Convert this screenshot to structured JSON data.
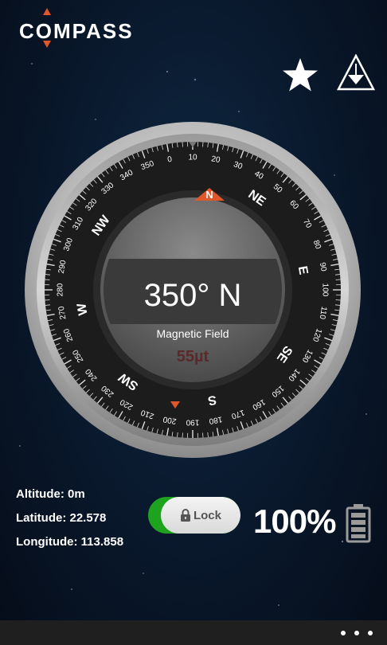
{
  "app": {
    "logo_text": "COMPASS",
    "accent_color": "#e0572b"
  },
  "header": {
    "favorite_icon": "star-icon",
    "calibrate_icon": "triangle-calibrate-icon"
  },
  "compass": {
    "heading_text": "350° N",
    "magnetic_label": "Magnetic Field",
    "magnetic_value": "55µt",
    "north_marker": "N",
    "south_marker": "S",
    "cardinals": [
      "N",
      "NE",
      "E",
      "SE",
      "S",
      "SW",
      "W",
      "NW"
    ],
    "degree_labels": [
      "0",
      "10",
      "20",
      "30",
      "40",
      "50",
      "60",
      "70",
      "80",
      "90",
      "100",
      "110",
      "120",
      "130",
      "140",
      "150",
      "160",
      "170",
      "180",
      "190",
      "200",
      "210",
      "220",
      "230",
      "240",
      "250",
      "260",
      "270",
      "280",
      "290",
      "300",
      "310",
      "320",
      "330",
      "340",
      "350"
    ]
  },
  "location": {
    "altitude": "Altitude: 0m",
    "latitude": "Latitude: 22.578",
    "longitude": "Longitude: 113.858"
  },
  "lock": {
    "label": "Lock",
    "state": "on",
    "on_color": "#1ea31e"
  },
  "battery": {
    "percent_text": "100%",
    "icon": "battery-icon"
  },
  "appbar": {
    "more_icon": "ellipsis-icon"
  }
}
